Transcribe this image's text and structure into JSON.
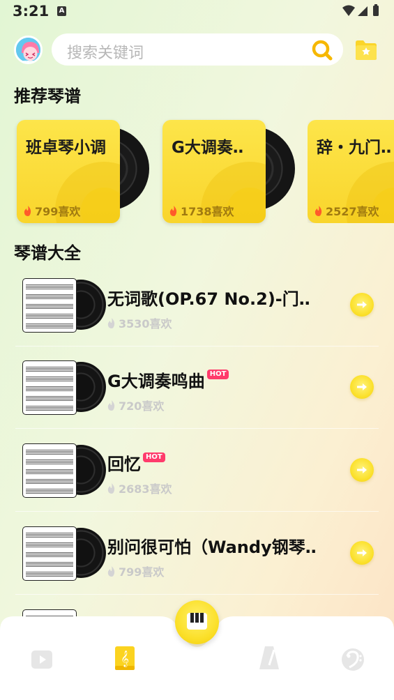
{
  "status_bar": {
    "time": "3:21",
    "badge": "A",
    "icons": [
      "wifi-icon",
      "signal-icon",
      "battery-icon"
    ]
  },
  "search": {
    "placeholder": "搜索关键词"
  },
  "recommended": {
    "title": "推荐琴谱",
    "cards": [
      {
        "title": "班卓琴小调",
        "likes": "799喜欢"
      },
      {
        "title": "G大调奏‥",
        "likes": "1738喜欢"
      },
      {
        "title": "辞・九门‥",
        "likes": "2527喜欢"
      }
    ]
  },
  "all_sheets": {
    "title": "琴谱大全",
    "hot_label": "HOT",
    "items": [
      {
        "title": "无词歌(OP.67  No.2)-门‥",
        "likes": "3530喜欢",
        "hot": false
      },
      {
        "title": "G大调奏鸣曲",
        "likes": "720喜欢",
        "hot": true
      },
      {
        "title": "回忆",
        "likes": "2683喜欢",
        "hot": true
      },
      {
        "title": "别问很可怕（Wandy钢琴‥",
        "likes": "799喜欢",
        "hot": false
      }
    ]
  },
  "colors": {
    "accent": "#fbe02a",
    "hot": "#ff3b6b",
    "flame": "#ff5a2a"
  },
  "bottom_nav": {
    "items": [
      {
        "icon": "video-icon",
        "active": false
      },
      {
        "icon": "music-book-icon",
        "active": true
      },
      {
        "icon": "piano-icon",
        "active": false,
        "center": true
      },
      {
        "icon": "metronome-icon",
        "active": false
      },
      {
        "icon": "bass-clef-icon",
        "active": false
      }
    ]
  }
}
